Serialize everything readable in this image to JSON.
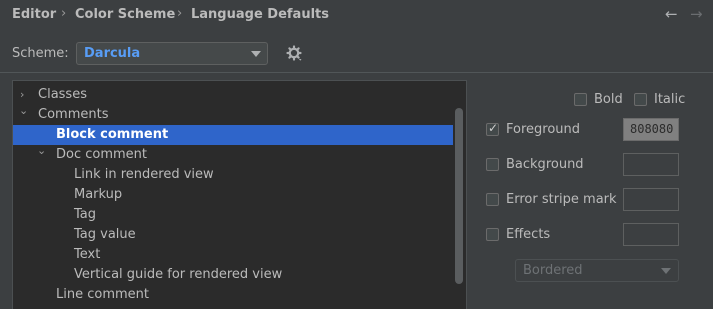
{
  "breadcrumb": {
    "items": [
      "Editor",
      "Color Scheme",
      "Language Defaults"
    ],
    "separator": "›",
    "back_icon": "←",
    "forward_icon": "→"
  },
  "scheme": {
    "label": "Scheme:",
    "value": "Darcula"
  },
  "tree": {
    "items": [
      {
        "label": "Classes",
        "expander": "›"
      },
      {
        "label": "Comments",
        "expander": "⌄"
      },
      {
        "label": "Block comment",
        "selected": true
      },
      {
        "label": "Doc comment",
        "expander": "⌄"
      },
      {
        "label": "Link in rendered view"
      },
      {
        "label": "Markup"
      },
      {
        "label": "Tag"
      },
      {
        "label": "Tag value"
      },
      {
        "label": "Text"
      },
      {
        "label": "Vertical guide for rendered view"
      },
      {
        "label": "Line comment"
      }
    ]
  },
  "options": {
    "bold": {
      "label": "Bold",
      "checked": false
    },
    "italic": {
      "label": "Italic",
      "checked": false
    },
    "foreground": {
      "label": "Foreground",
      "checked": true,
      "value": "808080",
      "color": "#808080"
    },
    "background": {
      "label": "Background",
      "checked": false
    },
    "error_stripe": {
      "label": "Error stripe mark",
      "checked": false
    },
    "effects": {
      "label": "Effects",
      "checked": false
    },
    "effect_type": "Bordered"
  },
  "colors": {
    "selection": "#2f65ca",
    "scheme_value": "#589df6"
  }
}
